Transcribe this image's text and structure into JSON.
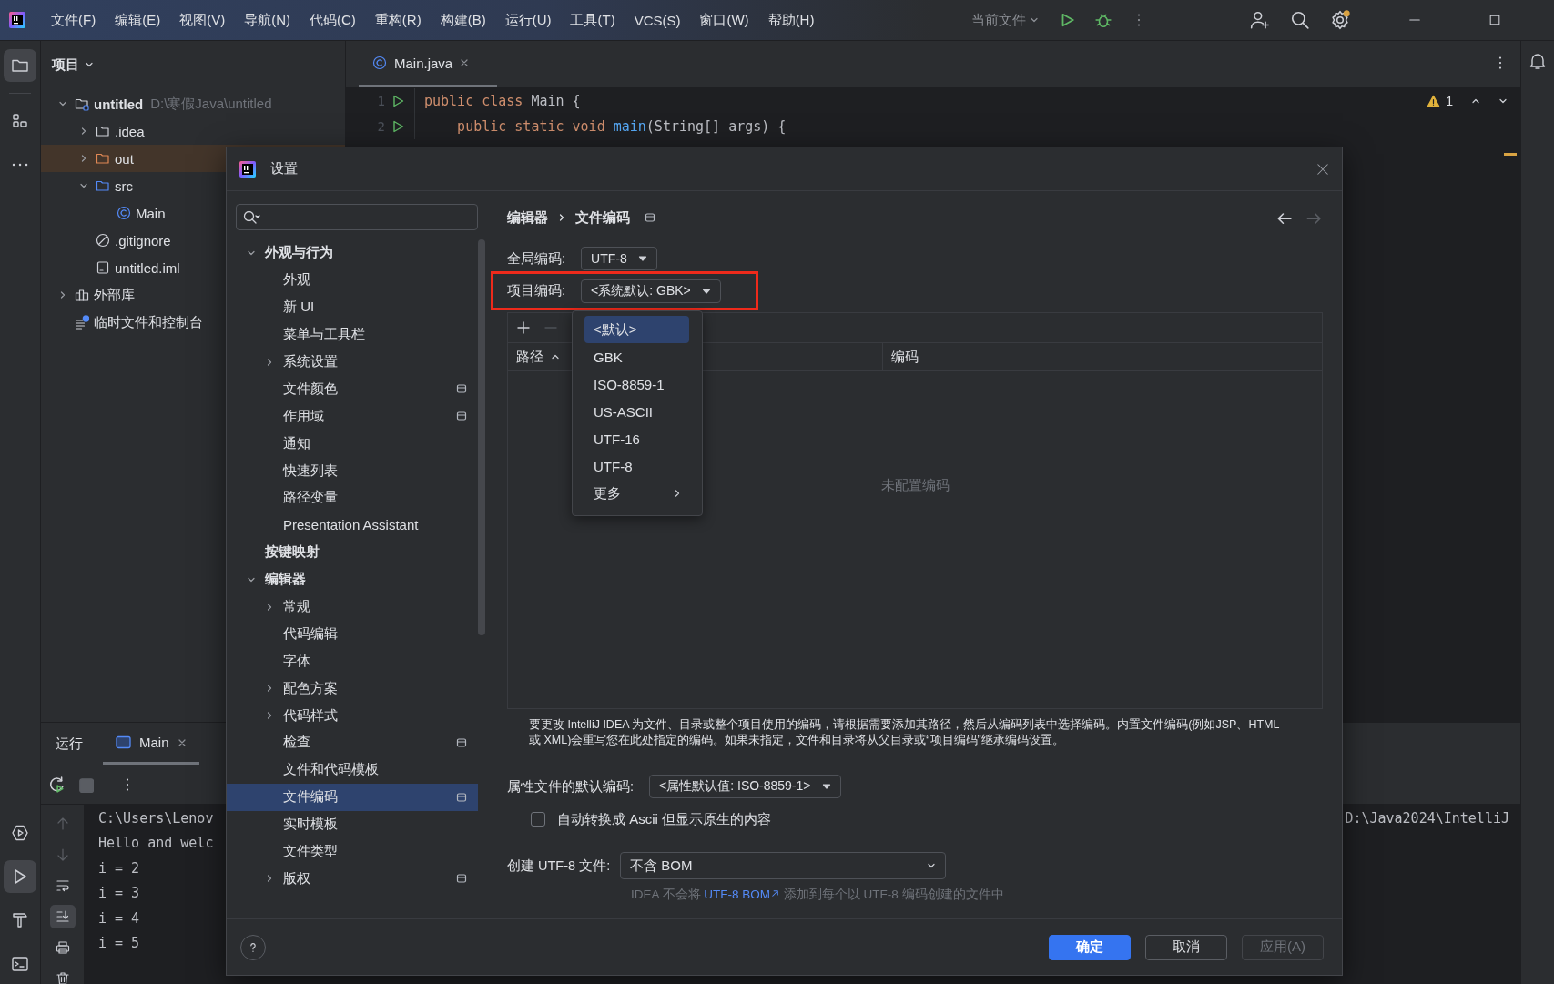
{
  "menu_bar": {
    "items": [
      "文件(F)",
      "编辑(E)",
      "视图(V)",
      "导航(N)",
      "代码(C)",
      "重构(R)",
      "构建(B)",
      "运行(U)",
      "工具(T)",
      "VCS(S)",
      "窗口(W)",
      "帮助(H)"
    ],
    "run_config": "当前文件"
  },
  "tool_strip": {
    "top": [
      {
        "kind": "project",
        "selected": true
      },
      {
        "kind": "structure",
        "selected": false
      },
      {
        "kind": "more",
        "selected": false
      }
    ],
    "bottom": [
      {
        "kind": "services",
        "selected": false
      },
      {
        "kind": "run",
        "selected": true
      },
      {
        "kind": "build",
        "selected": false
      },
      {
        "kind": "terminal",
        "selected": false
      }
    ]
  },
  "project": {
    "title": "项目",
    "tree": [
      {
        "label": "untitled",
        "path": "D:\\寒假Java\\untitled",
        "kind": "module",
        "expanded": true,
        "selected": false,
        "children": [
          {
            "label": ".idea",
            "kind": "folder",
            "expanded": false,
            "selected": false
          },
          {
            "label": "out",
            "kind": "excluded-folder",
            "expanded": false,
            "selected": true
          },
          {
            "label": "src",
            "kind": "source-folder",
            "expanded": true,
            "selected": false,
            "children": [
              {
                "label": "Main",
                "kind": "class",
                "selected": false
              }
            ]
          },
          {
            "label": ".gitignore",
            "kind": "ignore-file",
            "selected": false
          },
          {
            "label": "untitled.iml",
            "kind": "module-file",
            "selected": false
          }
        ]
      },
      {
        "label": "外部库",
        "kind": "libraries",
        "expanded": false,
        "selected": false
      },
      {
        "label": "临时文件和控制台",
        "kind": "scratches",
        "selected": false
      }
    ]
  },
  "editor": {
    "tabs": [
      {
        "label": "Main.java",
        "selected": true
      }
    ],
    "warnings": "1",
    "lines": [
      {
        "number": "1",
        "runnable": true,
        "tokens": [
          {
            "text": "public class ",
            "kind": "keyword"
          },
          {
            "text": "Main {",
            "kind": "plain"
          }
        ]
      },
      {
        "number": "2",
        "runnable": true,
        "tokens": [
          {
            "text": "    public static void ",
            "kind": "keyword"
          },
          {
            "text": "main",
            "kind": "function"
          },
          {
            "text": "(String[] args) {",
            "kind": "plain"
          }
        ]
      }
    ]
  },
  "run_panel": {
    "title": "运行",
    "tabs": [
      {
        "label": "Main",
        "selected": true
      }
    ],
    "scroll_to_end": true,
    "output": [
      {
        "text": "C:\\Users\\Lenov",
        "right_text": "D:\\Java2024\\IntelliJ"
      },
      {
        "text": "Hello and welc"
      },
      {
        "text": "i = 2"
      },
      {
        "text": "i = 3"
      },
      {
        "text": "i = 4"
      },
      {
        "text": "i = 5"
      }
    ]
  },
  "dialog": {
    "title": "设置",
    "nav": [
      {
        "label": "外观与行为",
        "expanded": true,
        "project_scope": false,
        "selected": false,
        "children": [
          {
            "label": "外观",
            "project_scope": false,
            "selected": false
          },
          {
            "label": "新 UI",
            "project_scope": false,
            "selected": false
          },
          {
            "label": "菜单与工具栏",
            "project_scope": false,
            "selected": false
          },
          {
            "label": "系统设置",
            "expanded": false,
            "project_scope": false,
            "selected": false
          },
          {
            "label": "文件颜色",
            "project_scope": true,
            "selected": false
          },
          {
            "label": "作用域",
            "project_scope": true,
            "selected": false
          },
          {
            "label": "通知",
            "project_scope": false,
            "selected": false
          },
          {
            "label": "快速列表",
            "project_scope": false,
            "selected": false
          },
          {
            "label": "路径变量",
            "project_scope": false,
            "selected": false
          },
          {
            "label": "Presentation Assistant",
            "project_scope": false,
            "selected": false
          }
        ]
      },
      {
        "label": "按键映射",
        "project_scope": false,
        "selected": false
      },
      {
        "label": "编辑器",
        "expanded": true,
        "project_scope": false,
        "selected": false,
        "children": [
          {
            "label": "常规",
            "expanded": false,
            "project_scope": false,
            "selected": false
          },
          {
            "label": "代码编辑",
            "project_scope": false,
            "selected": false
          },
          {
            "label": "字体",
            "project_scope": false,
            "selected": false
          },
          {
            "label": "配色方案",
            "expanded": false,
            "project_scope": false,
            "selected": false
          },
          {
            "label": "代码样式",
            "expanded": false,
            "project_scope": false,
            "selected": false
          },
          {
            "label": "检查",
            "project_scope": true,
            "selected": false
          },
          {
            "label": "文件和代码模板",
            "project_scope": false,
            "selected": false
          },
          {
            "label": "文件编码",
            "project_scope": true,
            "selected": true
          },
          {
            "label": "实时模板",
            "project_scope": false,
            "selected": false
          },
          {
            "label": "文件类型",
            "project_scope": false,
            "selected": false
          },
          {
            "label": "版权",
            "expanded": false,
            "project_scope": true,
            "selected": false
          }
        ]
      }
    ],
    "breadcrumb": [
      "编辑器",
      "文件编码"
    ],
    "page_project_scope": true,
    "history": {
      "back_disabled": false,
      "forward_disabled": true
    },
    "global_encoding": {
      "label": "全局编码:",
      "value": "UTF-8"
    },
    "project_encoding": {
      "label": "项目编码:",
      "value": "<系统默认: GBK>",
      "highlighted": true
    },
    "mapping_table": {
      "toolbar": [
        {
          "kind": "add",
          "disabled": false
        },
        {
          "kind": "remove",
          "disabled": true
        }
      ],
      "columns": [
        {
          "label": "路径",
          "sorted": true
        },
        {
          "label": "编码",
          "sorted": false
        }
      ],
      "empty_text": "未配置编码"
    },
    "description": "要更改 IntelliJ IDEA 为文件、目录或整个项目使用的编码，请根据需要添加其路径，然后从编码列表中选择编码。内置文件编码(例如JSP、HTML 或 XML)会重写您在此处指定的编码。如果未指定，文件和目录将从父目录或“项目编码”继承编码设置。",
    "properties_encoding": {
      "label": "属性文件的默认编码:",
      "value": "<属性默认值: ISO-8859-1>"
    },
    "native_to_ascii": {
      "label": "自动转换成 Ascii 但显示原生的内容",
      "checked": false
    },
    "bom": {
      "label": "创建 UTF-8 文件:",
      "value": "不含 BOM",
      "hint_before": "IDEA 不会将",
      "link": "UTF-8 BOM",
      "hint_after": "添加到每个以 UTF-8 编码创建的文件中"
    },
    "buttons": [
      {
        "label": "确定",
        "kind": "primary",
        "disabled": false
      },
      {
        "label": "取消",
        "kind": "default",
        "disabled": false
      },
      {
        "label": "应用(A)",
        "kind": "default",
        "disabled": true
      }
    ],
    "popup": {
      "items": [
        {
          "label": "<默认>",
          "kind": "option",
          "selected": true
        },
        {
          "label": "GBK",
          "kind": "option",
          "selected": false
        },
        {
          "label": "ISO-8859-1",
          "kind": "option",
          "selected": false
        },
        {
          "label": "US-ASCII",
          "kind": "option",
          "selected": false
        },
        {
          "label": "UTF-16",
          "kind": "option",
          "selected": false
        },
        {
          "label": "UTF-8",
          "kind": "option",
          "selected": false
        },
        {
          "label": "更多",
          "kind": "submenu",
          "selected": false
        }
      ]
    }
  }
}
